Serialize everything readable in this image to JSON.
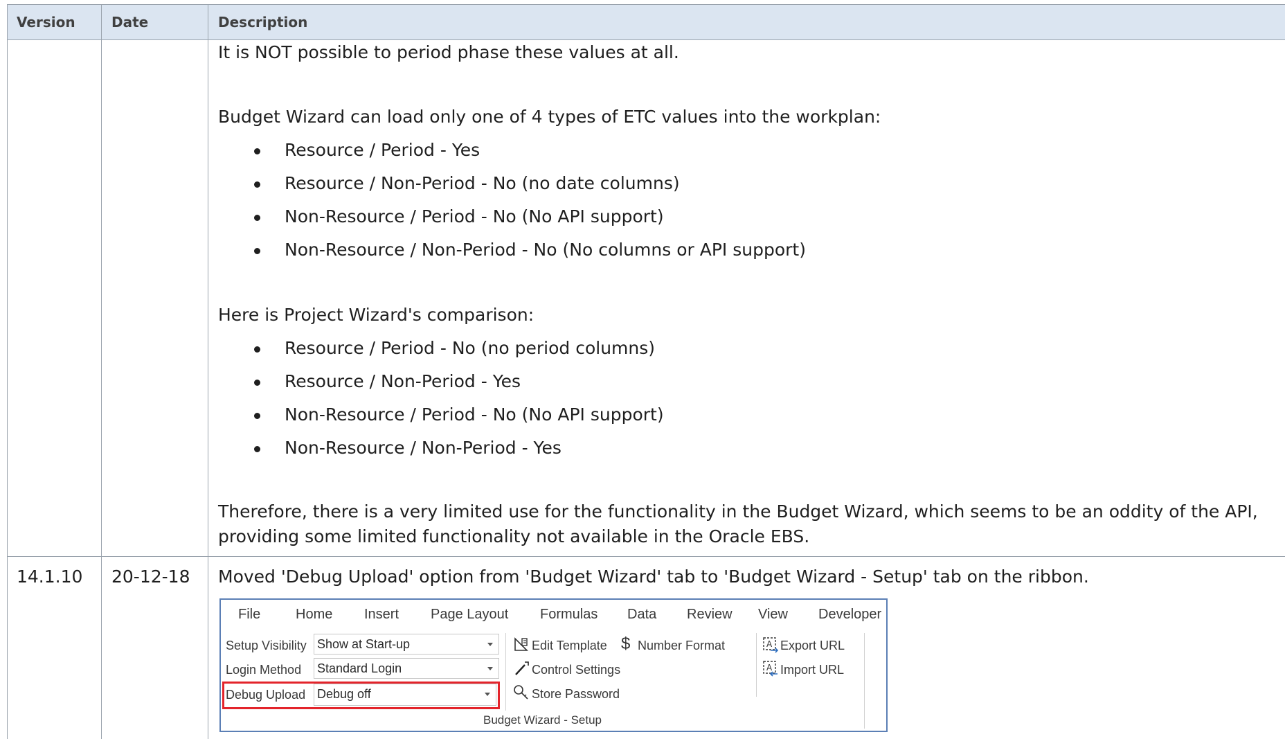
{
  "table": {
    "headers": {
      "version": "Version",
      "date": "Date",
      "description": "Description"
    },
    "row1": {
      "lines": [
        "It is NOT possible to period phase these values at all.",
        "Budget Wizard can load only one of 4 types of ETC values into the workplan:",
        "Here is Project Wizard's comparison:",
        "Therefore, there is a very limited use for the functionality in the Budget Wizard, which seems to be an oddity of the API,",
        "providing some limited functionality not available in the Oracle EBS."
      ],
      "budget_bullets": [
        "Resource / Period - Yes",
        "Resource / Non-Period - No (no date columns)",
        "Non-Resource / Period - No (No API support)",
        "Non-Resource / Non-Period - No (No columns or API support)"
      ],
      "project_bullets": [
        "Resource / Period - No (no period columns)",
        "Resource / Non-Period - Yes",
        "Non-Resource / Period - No (No API support)",
        "Non-Resource / Non-Period - Yes"
      ]
    },
    "row2": {
      "version": "14.1.10",
      "date": "20-12-18",
      "description": "Moved 'Debug Upload' option from 'Budget Wizard' tab to 'Budget Wizard - Setup' tab on the ribbon."
    }
  },
  "ribbon": {
    "tabs": [
      "File",
      "Home",
      "Insert",
      "Page Layout",
      "Formulas",
      "Data",
      "Review",
      "View",
      "Developer"
    ],
    "fields": {
      "setup_visibility": {
        "label": "Setup Visibility",
        "value": "Show at Start-up"
      },
      "login_method": {
        "label": "Login Method",
        "value": "Standard Login"
      },
      "debug_upload": {
        "label": "Debug Upload",
        "value": "Debug off"
      }
    },
    "commands": {
      "edit_template": "Edit Template",
      "control_settings": "Control Settings",
      "store_password": "Store Password",
      "number_format": "Number Format",
      "export_url": "Export URL",
      "import_url": "Import URL"
    },
    "group_label": "Budget Wizard - Setup",
    "highlight_color": "#e3242b"
  }
}
